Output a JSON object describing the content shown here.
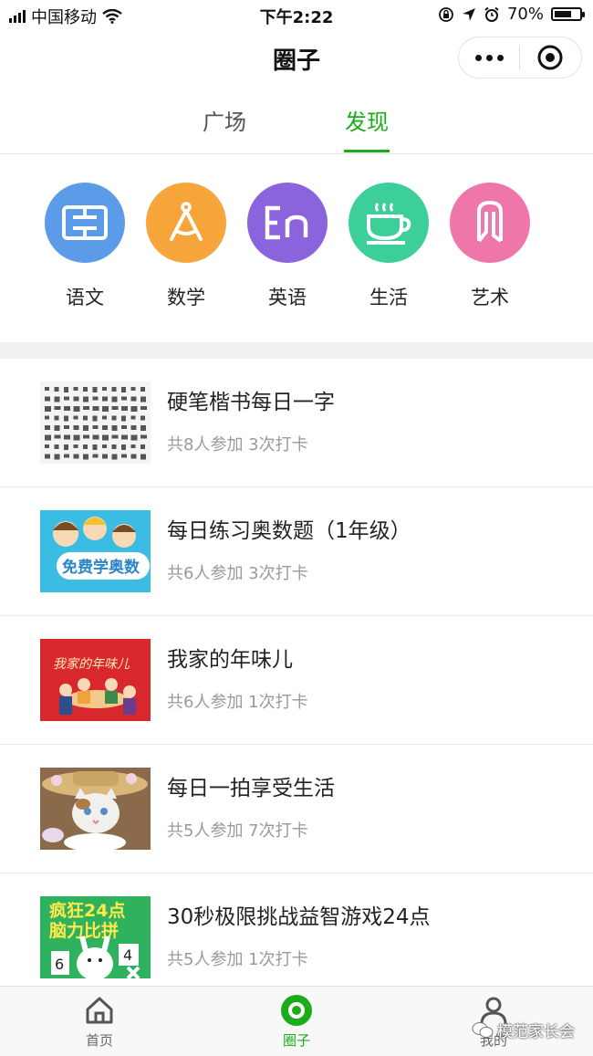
{
  "status": {
    "carrier": "中国移动",
    "time": "下午2:22",
    "battery_text": "70%",
    "battery_level": 0.7
  },
  "nav": {
    "title": "圈子",
    "more_icon": "more-dots-icon",
    "close_icon": "target-close-icon"
  },
  "tabs": [
    {
      "label": "广场",
      "active": false
    },
    {
      "label": "发现",
      "active": true
    }
  ],
  "categories": [
    {
      "label": "语文",
      "color": "#5b9be8",
      "icon": "book-icon"
    },
    {
      "label": "数学",
      "color": "#f5a53a",
      "icon": "compass-icon"
    },
    {
      "label": "英语",
      "color": "#8b63dd",
      "icon": "en-letters-icon"
    },
    {
      "label": "生活",
      "color": "#3ccf9a",
      "icon": "coffee-cup-icon"
    },
    {
      "label": "艺术",
      "color": "#ef76a8",
      "icon": "art-icon"
    }
  ],
  "items": [
    {
      "title": "硬笔楷书每日一字",
      "meta": "共8人参加 3次打卡"
    },
    {
      "title": "每日练习奥数题（1年级）",
      "meta": "共6人参加 3次打卡",
      "thumb_text": "免费学奥数"
    },
    {
      "title": "我家的年味儿",
      "meta": "共6人参加 1次打卡",
      "thumb_text": "我家的年味儿"
    },
    {
      "title": "每日一拍享受生活",
      "meta": "共5人参加 7次打卡"
    },
    {
      "title": "30秒极限挑战益智游戏24点",
      "meta": "共5人参加 1次打卡",
      "thumb_text_1": "疯狂24点",
      "thumb_text_2": "脑力比拼",
      "thumb_num_a": "6",
      "thumb_num_b": "4"
    }
  ],
  "tabbar": [
    {
      "label": "首页",
      "icon": "home-icon",
      "active": false
    },
    {
      "label": "圈子",
      "icon": "circle-icon",
      "active": true
    },
    {
      "label": "我的",
      "icon": "user-icon",
      "active": false
    }
  ],
  "watermark": "模范家长会",
  "colors": {
    "accent": "#1aad19",
    "meta_text": "#9a9a9a"
  }
}
